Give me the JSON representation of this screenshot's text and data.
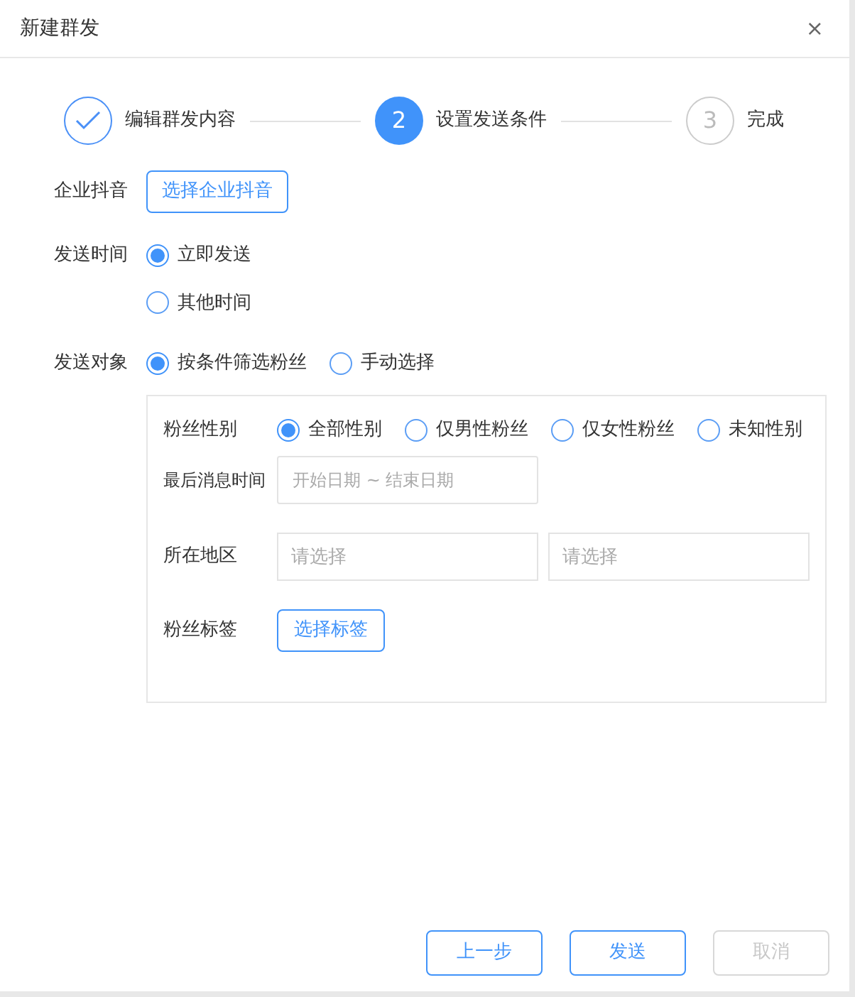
{
  "dialog": {
    "title": "新建群发",
    "close": "×"
  },
  "steps": [
    {
      "label": "编辑群发内容",
      "kind": "done"
    },
    {
      "number": "2",
      "label": "设置发送条件",
      "kind": "current"
    },
    {
      "number": "3",
      "label": "完成",
      "kind": "pending"
    }
  ],
  "account": {
    "label": "企业抖音",
    "button": "选择企业抖音"
  },
  "send_time": {
    "label": "发送时间",
    "options": [
      {
        "label": "立即发送",
        "selected": true
      },
      {
        "label": "其他时间",
        "selected": false
      }
    ]
  },
  "target": {
    "label": "发送对象",
    "options": [
      {
        "label": "按条件筛选粉丝",
        "selected": true
      },
      {
        "label": "手动选择",
        "selected": false
      }
    ]
  },
  "filters": {
    "gender": {
      "label": "粉丝性别",
      "options": [
        {
          "label": "全部性别",
          "selected": true
        },
        {
          "label": "仅男性粉丝",
          "selected": false
        },
        {
          "label": "仅女性粉丝",
          "selected": false
        },
        {
          "label": "未知性别",
          "selected": false
        }
      ]
    },
    "last_message": {
      "label": "最后消息时间",
      "placeholder": "开始日期 ~ 结束日期"
    },
    "region": {
      "label": "所在地区",
      "fields": [
        {
          "placeholder": "请选择"
        },
        {
          "placeholder": "请选择"
        }
      ]
    },
    "tags": {
      "label": "粉丝标签",
      "button": "选择标签"
    }
  },
  "buttons": [
    {
      "label": "上一步",
      "disabled": false
    },
    {
      "label": "发送",
      "disabled": false
    },
    {
      "label": "取消",
      "disabled": true
    }
  ]
}
